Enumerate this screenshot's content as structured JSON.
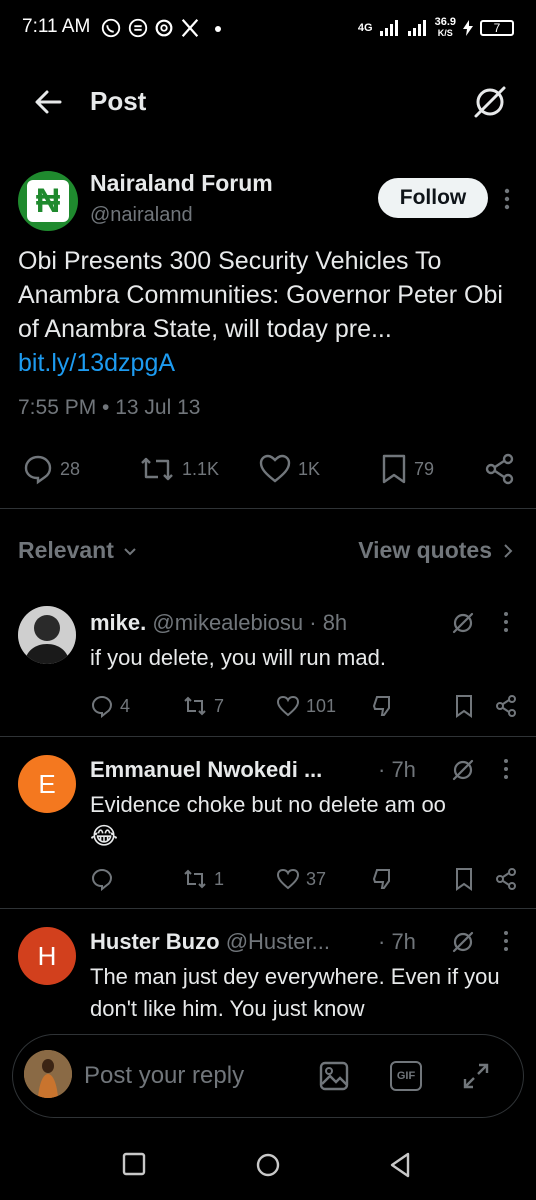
{
  "status_bar": {
    "time": "7:11 AM",
    "network": "4G",
    "speed_value": "36.9",
    "speed_unit": "K/S",
    "battery": "7"
  },
  "header": {
    "title": "Post",
    "back_icon": "arrow-left-icon",
    "grok_icon": "grok-icon"
  },
  "post": {
    "author": "Nairaland Forum",
    "handle": "@nairaland",
    "avatar_glyph": "₦",
    "follow_label": "Follow",
    "text": "Obi Presents 300 Security Vehicles To Anambra Communities: Governor Peter Obi of Anambra State, will today pre...",
    "link": "bit.ly/13dzpgA",
    "meta": "7:55 PM • 13 Jul 13",
    "replies": "28",
    "reposts": "1.1K",
    "likes": "1K",
    "bookmarks": "79"
  },
  "sort": {
    "label": "Relevant",
    "view_quotes": "View quotes"
  },
  "replies": [
    {
      "name": "mike.",
      "handle": "@mikealebiosu",
      "time": "· 8h",
      "text": "if you delete, you will run mad.",
      "replies": "4",
      "reposts": "7",
      "likes": "101",
      "avatar_color": "#3a3a3a"
    },
    {
      "name": "Emmanuel Nwokedi ...",
      "handle": "",
      "time": "· 7h",
      "text": "Evidence choke but no delete am oo",
      "emoji": "😂",
      "replies": "",
      "reposts": "1",
      "likes": "37",
      "avatar_letter": "E",
      "avatar_color": "#f4781f"
    },
    {
      "name": "Huster Buzo",
      "handle": "@Huster...",
      "time": "· 7h",
      "text": "The man just dey everywhere.  Even if you don't like him. You just know",
      "avatar_letter": "H",
      "avatar_color": "#d2401d"
    }
  ],
  "composer": {
    "placeholder": "Post your reply",
    "gif_label": "GIF"
  },
  "colors": {
    "background": "#000000",
    "text": "#e7e9ea",
    "muted": "#71767b",
    "link": "#1d9bf0",
    "divider": "#2f3336"
  }
}
